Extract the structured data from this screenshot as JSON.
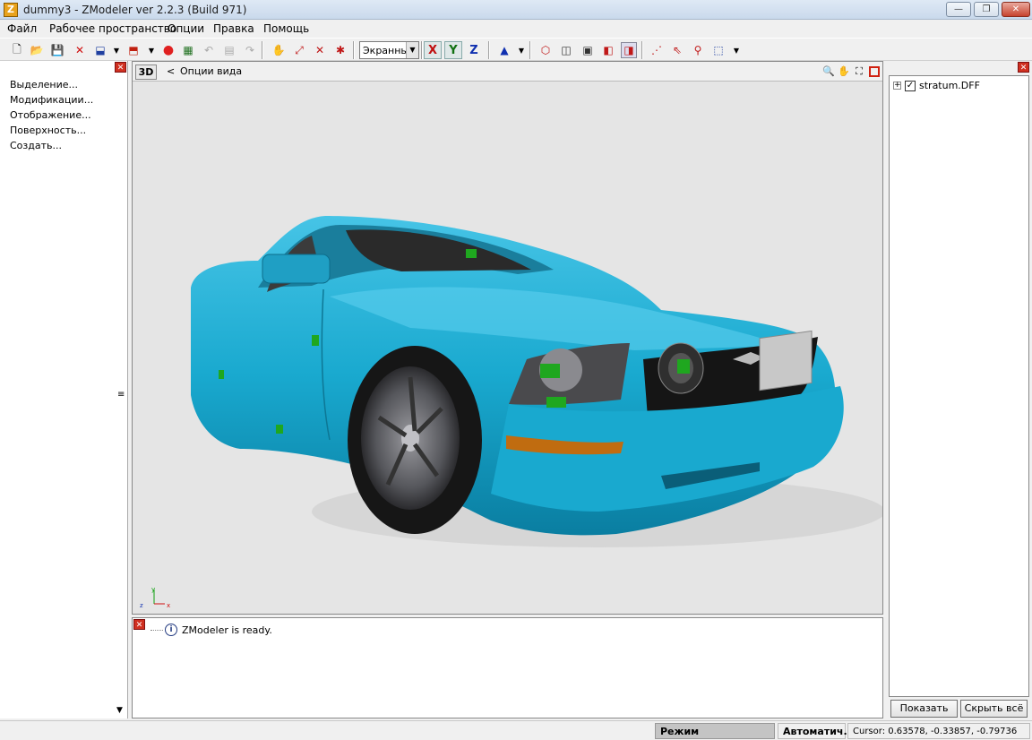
{
  "window": {
    "title": "dummy3 - ZModeler ver 2.2.3 (Build 971)",
    "icon_letter": "Z"
  },
  "menu": [
    "Файл",
    "Рабочее пространство",
    "Опции",
    "Правка",
    "Помощь"
  ],
  "toolbar": {
    "view_combo": "Экранны",
    "axis_x": "X",
    "axis_y": "Y",
    "axis_z": "Z"
  },
  "left_panel": {
    "items": [
      "Выделение...",
      "Модификации...",
      "Отображение...",
      "Поверхность...",
      "Создать..."
    ]
  },
  "viewport": {
    "mode": "3D",
    "back": "<",
    "options": "Опции вида",
    "axis_labels": {
      "y": "y",
      "z": "z",
      "x": "x"
    }
  },
  "console": {
    "message": "ZModeler is ready."
  },
  "right_panel": {
    "tree_item": "stratum.DFF",
    "show_all": "Показать всё",
    "hide_all": "Скрыть всё"
  },
  "statusbar": {
    "mode": "Режим Выделенного",
    "auto": "Автоматич.",
    "cursor": "Cursor: 0.63578, -0.33857, -0.79736"
  },
  "colors": {
    "car_body": "#19a9cf",
    "viewport_bg": "#e5e5e5",
    "helper_markers": "#1fa71f"
  }
}
